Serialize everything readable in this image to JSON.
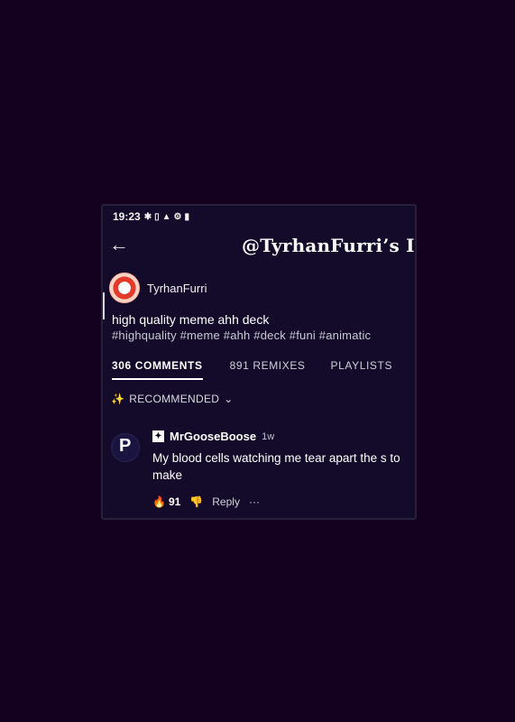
{
  "status_bar": {
    "time": "19:23",
    "icons": [
      "bluetooth-icon",
      "vibrate-icon",
      "warning-icon",
      "settings-icon",
      "battery-icon"
    ]
  },
  "header": {
    "title": "@TyrhanFurri’s I",
    "back_icon": "arrow-left-icon"
  },
  "post": {
    "author": "TyrhanFurri",
    "description": "high quality meme ahh deck",
    "tags": "#highquality #meme #ahh #deck #funi #animatic"
  },
  "tabs": [
    {
      "label": "306 COMMENTS",
      "active": true
    },
    {
      "label": "891 REMIXES",
      "active": false
    },
    {
      "label": "PLAYLISTS",
      "active": false
    }
  ],
  "sort": {
    "label": "RECOMMENDED"
  },
  "comment": {
    "username": "MrGooseBoose",
    "time": "1w",
    "text": "My blood cells watching me tear apart the s to make",
    "likes": "91",
    "reply_label": "Reply",
    "more": "···"
  },
  "colors": {
    "background": "#14001f",
    "screen": "#130b29"
  }
}
